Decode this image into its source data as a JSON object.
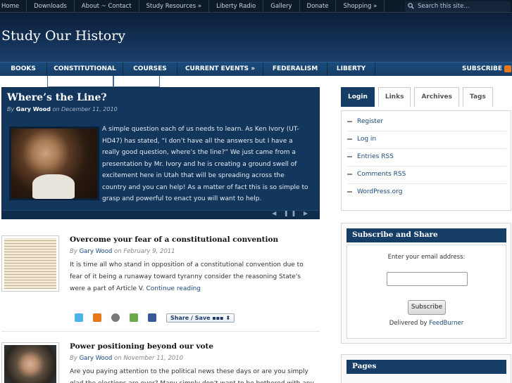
{
  "topnav": {
    "items": [
      "Home",
      "Downloads",
      "About ~ Contact",
      "Study Resources »",
      "Liberty Radio",
      "Gallery",
      "Donate",
      "Shopping »"
    ],
    "search_placeholder": "Search this site..."
  },
  "site": {
    "title": "Study Our History"
  },
  "mainnav": {
    "items": [
      "BOOKS",
      "CONSTITUTIONAL",
      "COURSES",
      "CURRENT EVENTS »",
      "FEDERALISM",
      "LIBERTY"
    ],
    "subscribe": "SUBSCRIBE"
  },
  "featured": {
    "title": "Where’s the Line?",
    "by": "By",
    "author": "Gary Wood",
    "on": "on",
    "date": "December 11, 2010",
    "text": "A simple question each of us needs to learn.  As Ken Ivory (UT-HD47) has stated, “I don’t have all the answers but I have a really good question, where’s the line?”  We just came from a presentation by Mr. Ivory and he is creating a ground swell of excitement here in Utah that will be spreading across the country and you can help!  As a matter of fact this is so simple to grasp and powerful to enact you will want to help.",
    "controls": "◀ ❚❚ ▶"
  },
  "posts": [
    {
      "title": "Overcome your fear of a constitutional convention",
      "by": "By",
      "author": "Gary Wood",
      "on": "on",
      "date": "February 9, 2011",
      "excerpt": "It is time all who stand in opposition of a constitutional convention due to fear of it being a runaway toward tyranny consider the reasoning State's were a part of Article V. ",
      "more": "Continue reading",
      "share_label": "Share / Save"
    },
    {
      "title": "Power positioning beyond our vote",
      "by": "By",
      "author": "Gary Wood",
      "on": "on",
      "date": "November 11, 2010",
      "excerpt": "Are you paying attention to the political news these days or are you simply glad the elections are over? Many simply don't want to be bothered with any more"
    }
  ],
  "sidebar": {
    "tabs": [
      "Login",
      "Links",
      "Archives",
      "Tags"
    ],
    "active_tab": "Login",
    "login_items": [
      "Register",
      "Log in",
      "Entries RSS",
      "Comments RSS",
      "WordPress.org"
    ],
    "subscribe_widget": {
      "title": "Subscribe and Share",
      "email_label": "Enter your email address:",
      "button": "Subscribe",
      "delivered_by": "Delivered by",
      "feedburner": "FeedBurner"
    },
    "pages_widget": {
      "title": "Pages"
    }
  },
  "colors": {
    "header_dark": "#0c1f38",
    "nav_blue": "#163d66",
    "link_blue": "#1a4a7a",
    "rss_orange": "#e8761a"
  }
}
